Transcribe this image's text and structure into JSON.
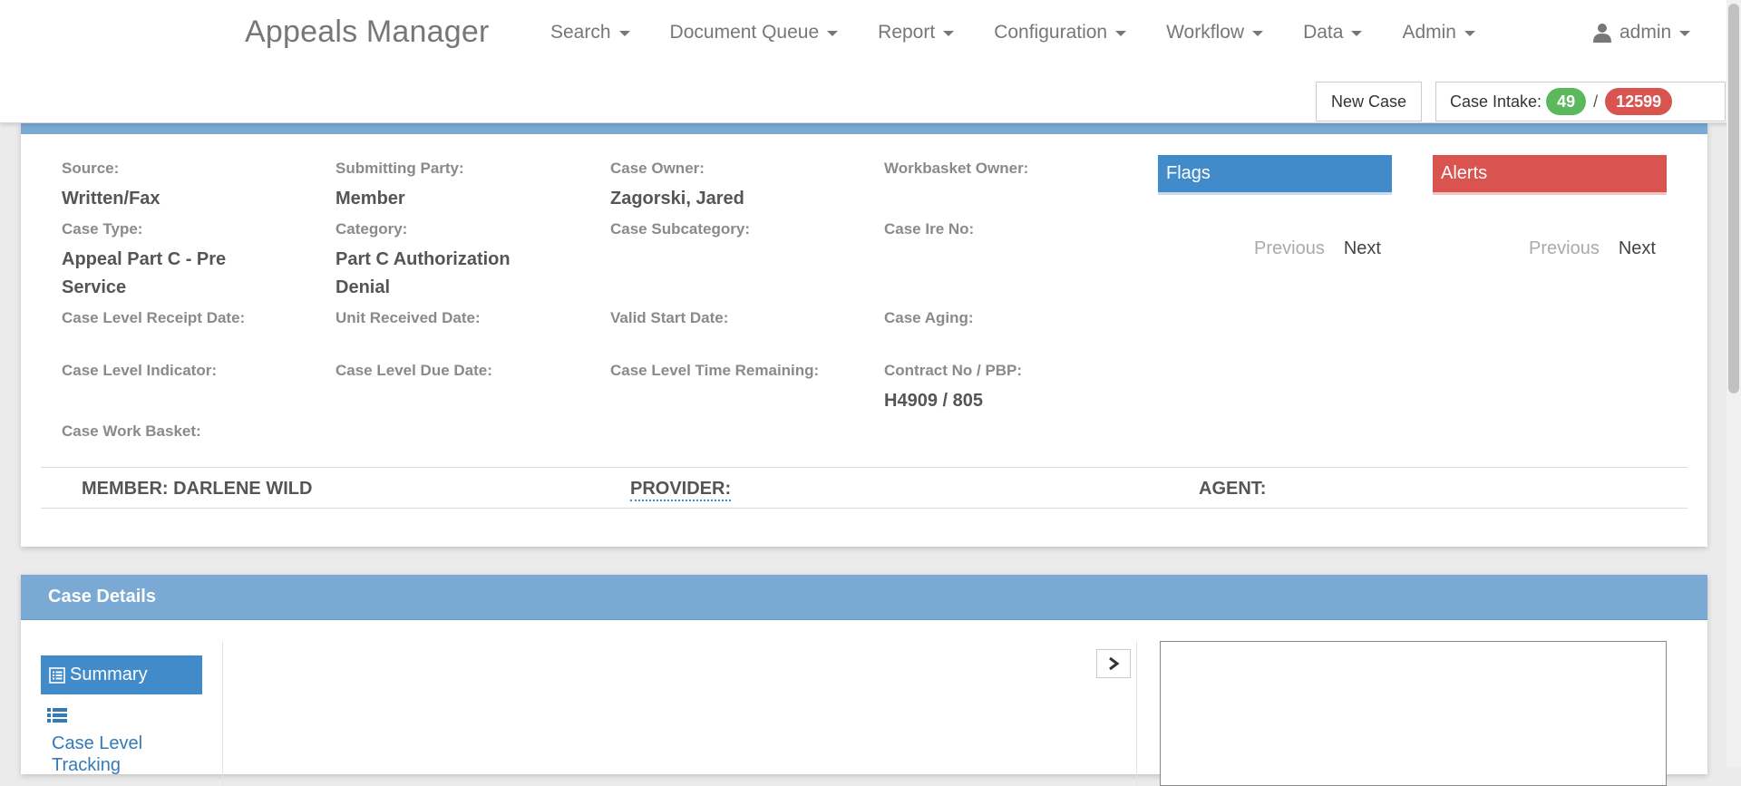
{
  "navbar": {
    "brand": "Appeals Manager",
    "menu": [
      {
        "label": "Search"
      },
      {
        "label": "Document Queue"
      },
      {
        "label": "Report"
      },
      {
        "label": "Configuration"
      },
      {
        "label": "Workflow"
      },
      {
        "label": "Data"
      },
      {
        "label": "Admin"
      }
    ],
    "user": "admin",
    "new_case_label": "New Case",
    "intake": {
      "label": "Case Intake:",
      "green_count": "49",
      "separator": "/",
      "red_count": "12599"
    }
  },
  "case_info": {
    "source": {
      "label": "Source:",
      "value": "Written/Fax"
    },
    "submitting_party": {
      "label": "Submitting Party:",
      "value": "Member"
    },
    "case_owner": {
      "label": "Case Owner:",
      "value": "Zagorski, Jared"
    },
    "workbasket_owner": {
      "label": "Workbasket Owner:",
      "value": ""
    },
    "case_type": {
      "label": "Case Type:",
      "value": "Appeal Part C - Pre Service"
    },
    "category": {
      "label": "Category:",
      "value": "Part C Authorization Denial"
    },
    "case_subcategory": {
      "label": "Case Subcategory:",
      "value": ""
    },
    "case_ire_no": {
      "label": "Case Ire No:",
      "value": ""
    },
    "case_level_receipt_date": {
      "label": "Case Level Receipt Date:",
      "value": ""
    },
    "unit_received_date": {
      "label": "Unit Received Date:",
      "value": ""
    },
    "valid_start_date": {
      "label": "Valid Start Date:",
      "value": ""
    },
    "case_aging": {
      "label": "Case Aging:",
      "value": ""
    },
    "case_level_indicator": {
      "label": "Case Level Indicator:",
      "value": ""
    },
    "case_level_due_date": {
      "label": "Case Level Due Date:",
      "value": ""
    },
    "case_level_time_remaining": {
      "label": "Case Level Time Remaining:",
      "value": ""
    },
    "contract_no_pbp": {
      "label": "Contract No / PBP:",
      "value": "H4909 / 805"
    },
    "case_work_basket": {
      "label": "Case Work Basket:",
      "value": ""
    }
  },
  "flags": {
    "title": "Flags",
    "prev": "Previous",
    "next": "Next"
  },
  "alerts": {
    "title": "Alerts",
    "prev": "Previous",
    "next": "Next"
  },
  "parties": {
    "member": "MEMBER: DARLENE WILD",
    "provider": "PROVIDER:",
    "agent": "AGENT:"
  },
  "case_details": {
    "title": "Case Details",
    "sidebar": [
      {
        "label": "Summary",
        "icon": "list-alt-icon",
        "active": true
      },
      {
        "label": "Case Level Tracking",
        "icon": "list-icon",
        "active": false
      }
    ]
  },
  "colors": {
    "panel_header": "#7aa9d3",
    "primary": "#428bca",
    "danger": "#d9534f",
    "success": "#5cb85c"
  }
}
